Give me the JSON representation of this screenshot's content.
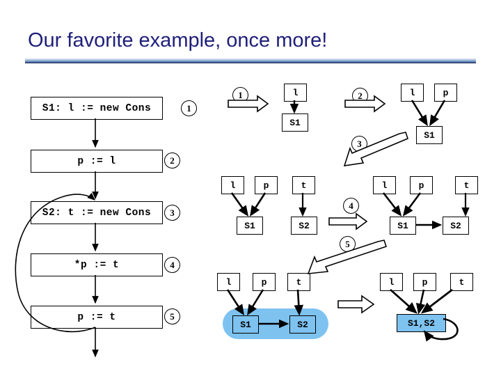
{
  "slide": {
    "title": "Our favorite example, once more!",
    "title_color": "#20207a",
    "background": "#ffffff",
    "highlight_color": "#7ec2f0"
  },
  "cfg": {
    "statements": [
      {
        "label": "S1: l := new Cons",
        "number": "1"
      },
      {
        "label": "p := l",
        "number": "2"
      },
      {
        "label": "S2: t := new Cons",
        "number": "3"
      },
      {
        "label": "*p := t",
        "number": "4"
      },
      {
        "label": "p := t",
        "number": "5"
      }
    ]
  },
  "steps": [
    {
      "number": "1",
      "nodes": [
        {
          "id": "s1-var-l",
          "label": "l"
        },
        {
          "id": "s1-heap-1",
          "label": "S1"
        }
      ]
    },
    {
      "number": "2",
      "nodes": [
        {
          "id": "s2-var-l",
          "label": "l"
        },
        {
          "id": "s2-var-p",
          "label": "p"
        },
        {
          "id": "s2-heap-1",
          "label": "S1"
        }
      ]
    },
    {
      "number": "3",
      "nodes": [
        {
          "id": "s3-var-l",
          "label": "l"
        },
        {
          "id": "s3-var-p",
          "label": "p"
        },
        {
          "id": "s3-var-t",
          "label": "t"
        },
        {
          "id": "s3-heap-1",
          "label": "S1"
        },
        {
          "id": "s3-heap-2",
          "label": "S2"
        }
      ]
    },
    {
      "number": "4",
      "nodes": [
        {
          "id": "s4-var-l",
          "label": "l"
        },
        {
          "id": "s4-var-p",
          "label": "p"
        },
        {
          "id": "s4-var-t",
          "label": "t"
        },
        {
          "id": "s4-heap-1",
          "label": "S1"
        },
        {
          "id": "s4-heap-2",
          "label": "S2"
        }
      ]
    },
    {
      "number": "5",
      "nodes": [
        {
          "id": "s5-var-l",
          "label": "l"
        },
        {
          "id": "s5-var-p",
          "label": "p"
        },
        {
          "id": "s5-var-t",
          "label": "t"
        },
        {
          "id": "s5-heap-1",
          "label": "S1"
        },
        {
          "id": "s5-heap-2",
          "label": "S2"
        }
      ]
    },
    {
      "number": "",
      "nodes": [
        {
          "id": "s6-var-l",
          "label": "l"
        },
        {
          "id": "s6-var-p",
          "label": "p"
        },
        {
          "id": "s6-var-t",
          "label": "t"
        },
        {
          "id": "s6-heap-m",
          "label": "S1,S2"
        }
      ]
    }
  ]
}
